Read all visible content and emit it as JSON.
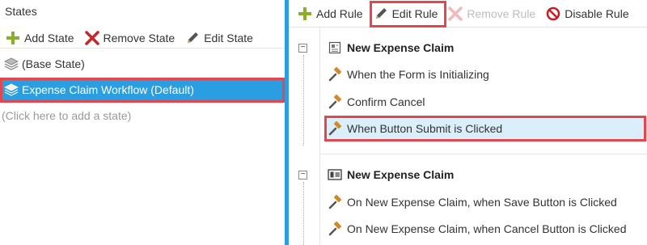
{
  "states_panel": {
    "title": "States",
    "toolbar": {
      "add_state": "Add State",
      "remove_state": "Remove State",
      "edit_state": "Edit State"
    },
    "items": [
      {
        "label": "(Base State)",
        "icon": "layers-icon",
        "selected": false
      },
      {
        "label": "Expense Claim Workflow (Default)",
        "icon": "layers-icon",
        "selected": true
      }
    ],
    "add_placeholder": "(Click here to add a state)"
  },
  "rules_panel": {
    "toolbar": {
      "add_rule": "Add Rule",
      "edit_rule": "Edit Rule",
      "remove_rule": "Remove Rule",
      "disable_rule": "Disable Rule"
    },
    "groups": [
      {
        "toggle": "−",
        "title": "New Expense Claim",
        "icon": "form-icon",
        "rules": [
          {
            "label": "When the Form is Initializing",
            "icon": "gavel-icon"
          },
          {
            "label": "Confirm Cancel",
            "icon": "gavel-icon"
          },
          {
            "label": "When Button Submit is Clicked",
            "icon": "gavel-icon",
            "selected": true
          }
        ]
      },
      {
        "toggle": "−",
        "title": "New Expense Claim",
        "icon": "view-icon",
        "rules": [
          {
            "label": "On New Expense Claim, when Save Button is Clicked",
            "icon": "gavel-icon"
          },
          {
            "label": "On New Expense Claim, when Cancel Button is Clicked",
            "icon": "gavel-icon"
          }
        ]
      }
    ]
  },
  "colors": {
    "selection": "#2a9ee0",
    "highlight_row": "#dbeefb",
    "annotation_box": "#e0484e",
    "add_green": "#8dae2a",
    "remove_red": "#c0282d",
    "disable_red": "#c41e24"
  }
}
